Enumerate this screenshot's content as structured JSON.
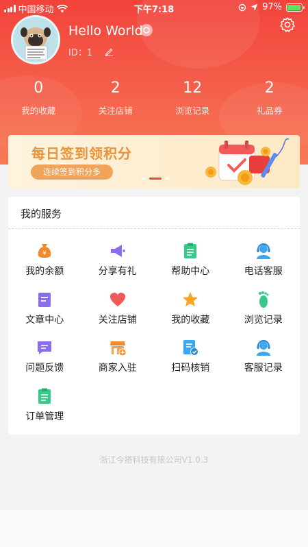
{
  "status_bar": {
    "carrier": "中国移动",
    "time": "下午7:18",
    "battery": "97%"
  },
  "user": {
    "name": "Hello World",
    "id_label": "ID：1"
  },
  "stats": [
    {
      "num": "0",
      "label": "我的收藏"
    },
    {
      "num": "2",
      "label": "关注店铺"
    },
    {
      "num": "12",
      "label": "浏览记录"
    },
    {
      "num": "2",
      "label": "礼品券"
    }
  ],
  "banner": {
    "title": "每日签到领积分",
    "subtitle": "连续签到积分多"
  },
  "services": {
    "title": "我的服务",
    "items": [
      {
        "label": "我的余额",
        "icon": "money-bag-icon",
        "color": "#f08a2a"
      },
      {
        "label": "分享有礼",
        "icon": "megaphone-icon",
        "color": "#8a6cf0"
      },
      {
        "label": "帮助中心",
        "icon": "clipboard-icon",
        "color": "#37c98a"
      },
      {
        "label": "电话客服",
        "icon": "headset-icon",
        "color": "#3ba7f0"
      },
      {
        "label": "文章中心",
        "icon": "document-icon",
        "color": "#8a6cf0"
      },
      {
        "label": "关注店铺",
        "icon": "heart-icon",
        "color": "#f25a5a"
      },
      {
        "label": "我的收藏",
        "icon": "star-icon",
        "color": "#f5a623"
      },
      {
        "label": "浏览记录",
        "icon": "footprint-icon",
        "color": "#37c98a"
      },
      {
        "label": "问题反馈",
        "icon": "chat-bubble-icon",
        "color": "#8a6cf0"
      },
      {
        "label": "商家入驻",
        "icon": "shop-icon",
        "color": "#f08a2a"
      },
      {
        "label": "扫码核销",
        "icon": "scan-check-icon",
        "color": "#3ba7f0"
      },
      {
        "label": "客服记录",
        "icon": "service-agent-icon",
        "color": "#3ba7f0"
      },
      {
        "label": "订单管理",
        "icon": "order-list-icon",
        "color": "#37c98a"
      }
    ]
  },
  "footer": {
    "text": "浙江今搭科技有限公司V1.0.3"
  }
}
